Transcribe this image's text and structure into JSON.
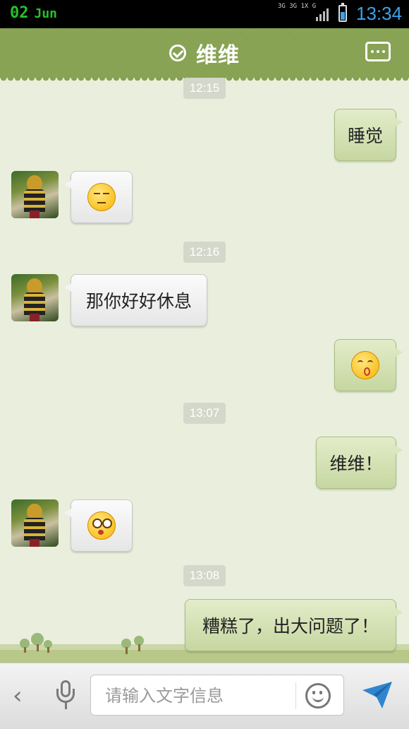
{
  "status_bar": {
    "date_day": "02",
    "date_month": "Jun",
    "network_top": "3G 3G 1X G",
    "time": "13:34",
    "battery_level": 0.6
  },
  "header": {
    "title": "维维",
    "verified_icon": "check-circle-icon",
    "menu_icon": "more-dots-icon"
  },
  "messages": [
    {
      "type": "timestamp",
      "text": "12:15"
    },
    {
      "type": "outgoing",
      "text": "睡觉"
    },
    {
      "type": "incoming",
      "emoji": "annoyed-face"
    },
    {
      "type": "timestamp",
      "text": "12:16"
    },
    {
      "type": "incoming",
      "text": "那你好好休息"
    },
    {
      "type": "outgoing",
      "emoji": "kissing-face"
    },
    {
      "type": "timestamp",
      "text": "13:07"
    },
    {
      "type": "outgoing",
      "text": "维维！"
    },
    {
      "type": "incoming",
      "emoji": "dizzy-face"
    },
    {
      "type": "timestamp",
      "text": "13:08"
    },
    {
      "type": "outgoing",
      "text": "糟糕了，出大问题了！"
    }
  ],
  "input_bar": {
    "placeholder": "请输入文字信息",
    "value": "",
    "icons": [
      "back-chevron-icon",
      "microphone-icon",
      "smiley-icon",
      "send-arrow-icon"
    ]
  },
  "colors": {
    "header": "#8aa556",
    "outgoing_bubble": "#d2e0b0",
    "incoming_bubble": "#f2f2f2",
    "timestamp_bg": "#d4d8cb",
    "accent": "#3aa3e8"
  }
}
